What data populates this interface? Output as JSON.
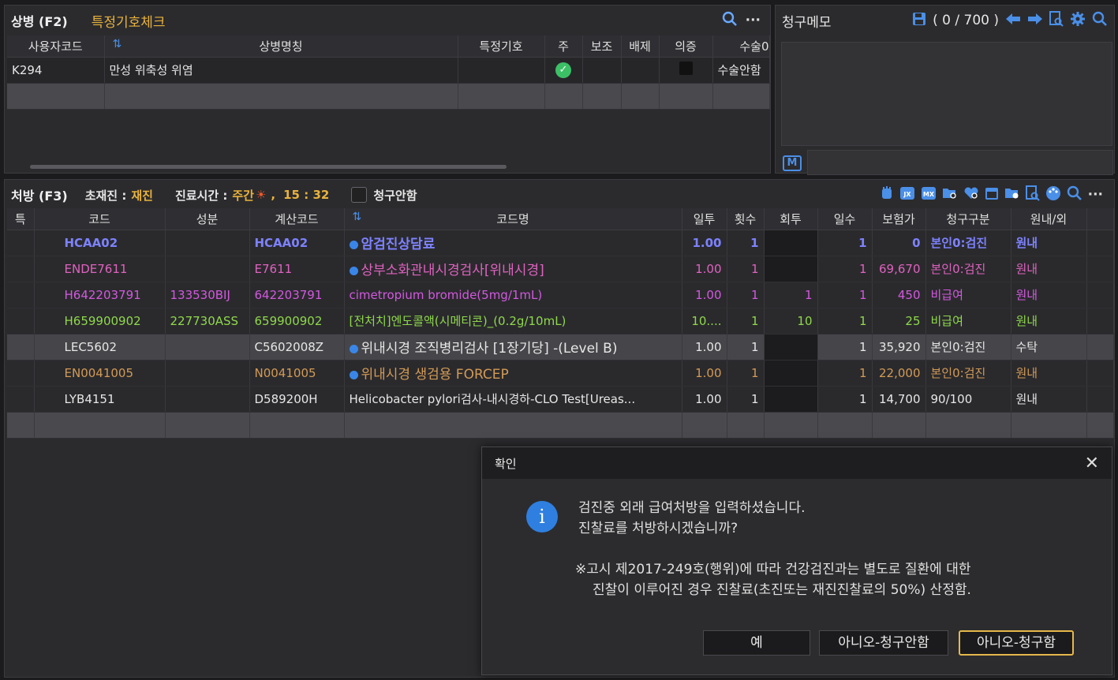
{
  "diagnosis": {
    "title": "상병 (F2)",
    "special_check": "특정기호체크",
    "columns": [
      "사용자코드",
      "상병명칭",
      "특정기호",
      "주",
      "보조",
      "배제",
      "의증",
      "수술0"
    ],
    "rows": [
      {
        "code": "K294",
        "name": "만성 위축성 위염",
        "special": "",
        "main": true,
        "sub": "",
        "exclude": "",
        "suspect": false,
        "surgery": "수술안함"
      }
    ]
  },
  "memo": {
    "title": "청구메모",
    "count": "( 0 / 700 )",
    "m_label": "M"
  },
  "prescription": {
    "title": "처방 (F3)",
    "visit_label": "초재진 :",
    "visit_value": "재진",
    "time_label": "진료시간 :",
    "time_value": "주간",
    "time_sep": ",",
    "time_clock": "15 : 32",
    "no_claim_label": "청구안함",
    "columns": [
      "특",
      "코드",
      "성분",
      "계산코드",
      "코드명",
      "일투",
      "횟수",
      "회투",
      "일수",
      "보험가",
      "청구구분",
      "원내/외"
    ],
    "rows": [
      {
        "code": "HCAA02",
        "ingredient": "",
        "calc_code": "HCAA02",
        "name": "암검진상담료",
        "daily": "1.00",
        "times": "1",
        "per": "",
        "days": "1",
        "price": "0",
        "claim": "본인0:검진",
        "place": "원내",
        "dot": true
      },
      {
        "code": "ENDE7611",
        "ingredient": "",
        "calc_code": "E7611",
        "name": "상부소화관내시경검사[위내시경]",
        "daily": "1.00",
        "times": "1",
        "per": "",
        "days": "1",
        "price": "69,670",
        "claim": "본인0:검진",
        "place": "원내",
        "dot": true
      },
      {
        "code": "H642203791",
        "ingredient": "133530BIJ",
        "calc_code": "642203791",
        "name": "cimetropium bromide(5mg/1mL)",
        "daily": "1.00",
        "times": "1",
        "per": "1",
        "days": "1",
        "price": "450",
        "claim": "비급여",
        "place": "원내",
        "dot": false
      },
      {
        "code": "H659900902",
        "ingredient": "227730ASS",
        "calc_code": "659900902",
        "name": "[전처치]엔도콜액(시메티콘)_(0.2g/10mL)",
        "daily": "10....",
        "times": "1",
        "per": "10",
        "days": "1",
        "price": "25",
        "claim": "비급여",
        "place": "원내",
        "dot": false
      },
      {
        "code": "LEC5602",
        "ingredient": "",
        "calc_code": "C5602008Z",
        "name": "위내시경 조직병리검사 [1장기당] -(Level B)",
        "daily": "1.00",
        "times": "1",
        "per": "",
        "days": "1",
        "price": "35,920",
        "claim": "본인0:검진",
        "place": "수탁",
        "dot": true
      },
      {
        "code": "EN0041005",
        "ingredient": "",
        "calc_code": "N0041005",
        "name": "위내시경 생검용 FORCEP",
        "daily": "1.00",
        "times": "1",
        "per": "",
        "days": "1",
        "price": "22,000",
        "claim": "본인0:검진",
        "place": "원내",
        "dot": true
      },
      {
        "code": "LYB4151",
        "ingredient": "",
        "calc_code": "D589200H",
        "name": "Helicobacter pylori검사-내시경하-CLO Test[Ureas...",
        "daily": "1.00",
        "times": "1",
        "per": "",
        "days": "1",
        "price": "14,700",
        "claim": "90/100",
        "place": "원내",
        "dot": false
      }
    ]
  },
  "dialog": {
    "title": "확인",
    "line1": "검진중 외래 급여처방을 입력하셨습니다.",
    "line2": "진찰료를 처방하시겠습니까?",
    "note1": "※고시 제2017-249호(행위)에 따라 건강검진과는 별도로 질환에 대한",
    "note2": "진찰이 이루어진 경우 진찰료(초진또는 재진진찰료의 50%) 산정함.",
    "btn_yes": "예",
    "btn_no_noclaim": "아니오-청구안함",
    "btn_no_claim": "아니오-청구함"
  },
  "colors": {
    "accent_blue": "#4a8fe8",
    "yellow": "#e9b23c",
    "focus_border": "#e6b84a"
  }
}
